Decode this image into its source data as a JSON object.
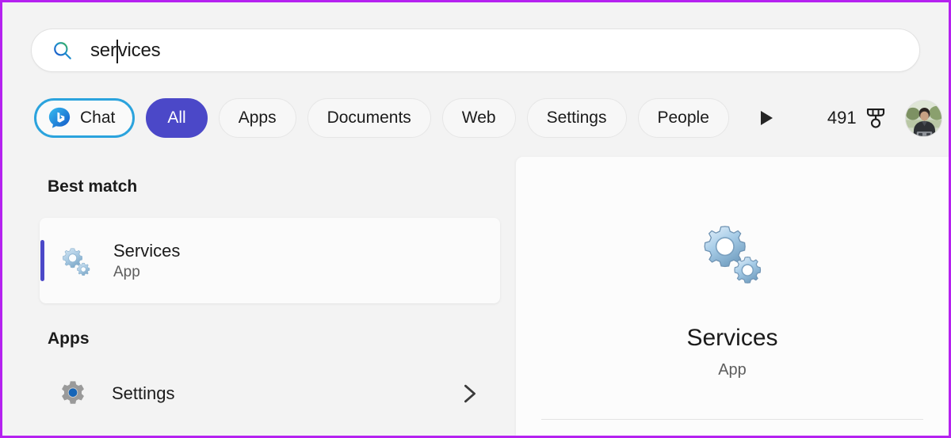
{
  "window": {
    "app": "Windows Search",
    "border_color": "#b521f0",
    "background_color": "#f3f3f3"
  },
  "search": {
    "icon": "search-icon",
    "value": "services",
    "value_before_caret": "ser",
    "value_after_caret": "vices",
    "placeholder": "Type here to search",
    "caret_visible": true
  },
  "filters": {
    "chat": {
      "label": "Chat",
      "icon": "bing-chat-icon",
      "outline_color": "#2ba3dd",
      "selected": false
    },
    "items": [
      {
        "label": "All",
        "selected": true
      },
      {
        "label": "Apps",
        "selected": false
      },
      {
        "label": "Documents",
        "selected": false
      },
      {
        "label": "Web",
        "selected": false
      },
      {
        "label": "Settings",
        "selected": false
      },
      {
        "label": "People",
        "selected": false
      }
    ],
    "more_arrow_icon": "play-triangle-right-icon",
    "selected_color": "#4b48c8"
  },
  "rewards": {
    "count": "491",
    "icon": "medal-icon"
  },
  "account": {
    "avatar_icon": "avatar"
  },
  "results": {
    "best_match": {
      "heading": "Best match",
      "item": {
        "title": "Services",
        "subtitle": "App",
        "icon": "gears-icon",
        "accent_color": "#4b48c8",
        "selected": true
      }
    },
    "apps": {
      "heading": "Apps",
      "items": [
        {
          "title": "Settings",
          "icon": "settings-gear-icon",
          "chevron": "chevron-right-icon"
        }
      ]
    }
  },
  "preview": {
    "icon": "gears-icon-large",
    "title": "Services",
    "subtitle": "App"
  }
}
